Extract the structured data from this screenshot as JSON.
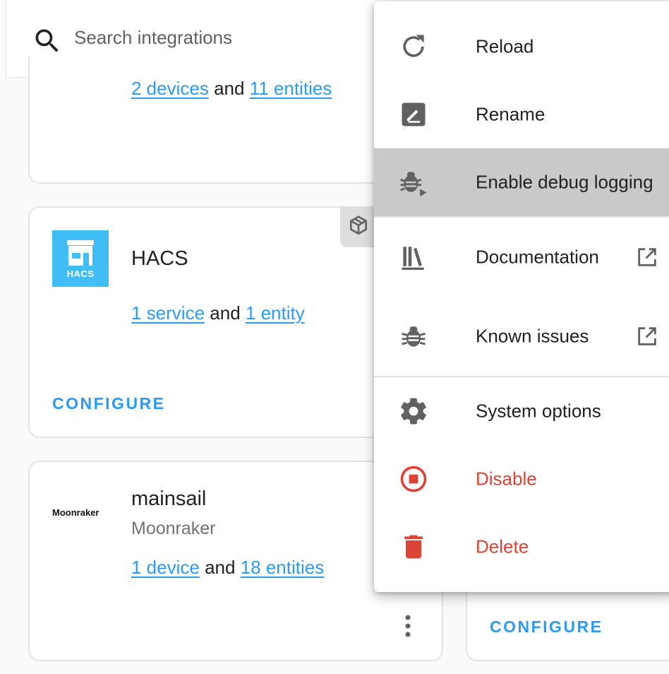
{
  "search": {
    "placeholder": "Search integrations"
  },
  "cards": {
    "top": {
      "devices": "2 devices",
      "and": "and",
      "entities": "11 entities"
    },
    "hacs": {
      "logo_text": "HACS",
      "title": "HACS",
      "service": "1 service",
      "and": "and",
      "entity": "1 entity",
      "configure": "CONFIGURE"
    },
    "mainsail": {
      "logo_text": "Moonraker",
      "title": "mainsail",
      "subtitle": "Moonraker",
      "device": "1 device",
      "and": "and",
      "entities": "18 entities"
    },
    "right": {
      "configure": "CONFIGURE"
    }
  },
  "menu": {
    "items": [
      {
        "label": "Reload",
        "icon": "reload-icon"
      },
      {
        "label": "Rename",
        "icon": "rename-icon"
      },
      {
        "label": "Enable debug logging",
        "icon": "bug-play-icon",
        "highlighted": true
      },
      {
        "label": "Documentation",
        "icon": "bookshelf-icon",
        "external": true
      },
      {
        "label": "Known issues",
        "icon": "bug-icon",
        "external": true
      },
      {
        "label": "System options",
        "icon": "gear-icon"
      },
      {
        "label": "Disable",
        "icon": "stop-circle-icon",
        "danger": true
      },
      {
        "label": "Delete",
        "icon": "trash-icon",
        "danger": true
      }
    ]
  },
  "colors": {
    "link": "#2b9af3",
    "danger": "#db4437",
    "hacs_brand": "#41bdf5",
    "highlight": "#c9c9c9"
  }
}
